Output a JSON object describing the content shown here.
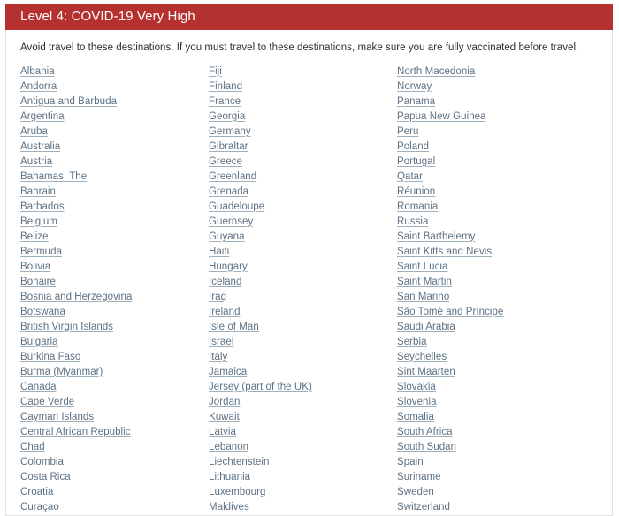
{
  "panel": {
    "header_title": "Level 4: COVID-19 Very High",
    "header_color": "#b5312f",
    "link_color": "#5d7284",
    "intro_text": "Avoid travel to these destinations. If you must travel to these destinations, make sure you are fully vaccinated before travel."
  },
  "columns": [
    {
      "id": "column-1",
      "destinations": [
        "Albania",
        "Andorra",
        "Antigua and Barbuda",
        "Argentina",
        "Aruba",
        "Australia",
        "Austria",
        "Bahamas, The",
        "Bahrain",
        "Barbados",
        "Belgium",
        "Belize",
        "Bermuda",
        "Bolivia",
        "Bonaire",
        "Bosnia and Herzegovina",
        "Botswana",
        "British Virgin Islands",
        "Bulgaria",
        "Burkina Faso",
        "Burma (Myanmar)",
        "Canada",
        "Cape Verde",
        "Cayman Islands",
        "Central African Republic",
        "Chad",
        "Colombia",
        "Costa Rica",
        "Croatia",
        "Curaçao"
      ]
    },
    {
      "id": "column-2",
      "destinations": [
        "Fiji",
        "Finland",
        "France",
        "Georgia",
        "Germany",
        "Gibraltar",
        "Greece",
        "Greenland",
        "Grenada",
        "Guadeloupe",
        "Guernsey",
        "Guyana",
        "Haiti",
        "Hungary",
        "Iceland",
        "Iraq",
        "Ireland",
        "Isle of Man",
        "Israel",
        "Italy",
        "Jamaica",
        "Jersey (part of the UK)",
        "Jordan",
        "Kuwait",
        "Latvia",
        "Lebanon",
        "Liechtenstein",
        "Lithuania",
        "Luxembourg",
        "Maldives"
      ]
    },
    {
      "id": "column-3",
      "destinations": [
        "North Macedonia",
        "Norway",
        "Panama",
        "Papua New Guinea",
        "Peru",
        "Poland",
        "Portugal",
        "Qatar",
        "Réunion",
        "Romania",
        "Russia",
        "Saint Barthelemy",
        "Saint Kitts and Nevis",
        "Saint Lucia",
        "Saint Martin",
        "San Marino",
        "São Tomé and Príncipe",
        "Saudi Arabia",
        "Serbia",
        "Seychelles",
        "Sint Maarten",
        "Slovakia",
        "Slovenia",
        "Somalia",
        "South Africa",
        "South Sudan",
        "Spain",
        "Suriname",
        "Sweden",
        "Switzerland"
      ]
    }
  ]
}
